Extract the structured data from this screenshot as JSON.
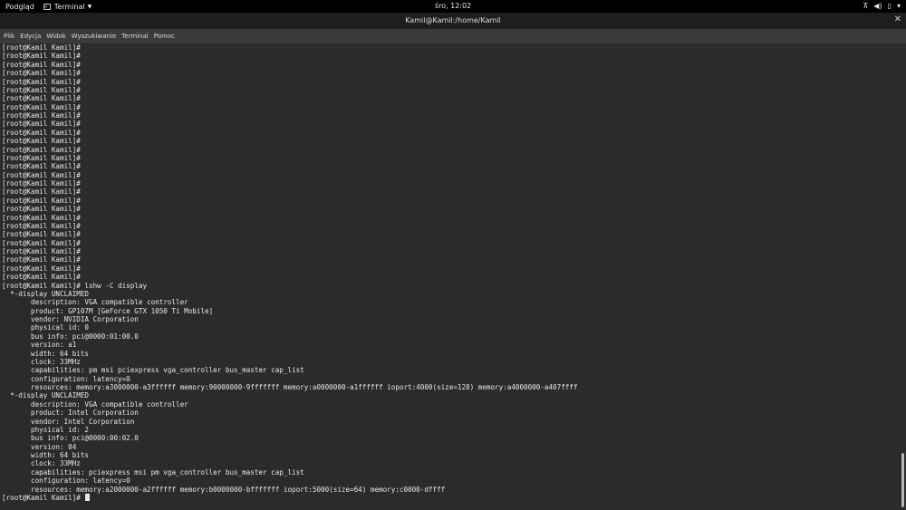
{
  "topbar": {
    "activities": "Podgląd",
    "app_name": "Terminal",
    "clock": "śro, 12:02",
    "tray_icons": [
      "network-icon",
      "volume-icon",
      "battery-icon",
      "power-menu-icon"
    ]
  },
  "window": {
    "title": "Kamil@Kamil:/home/Kamil",
    "close_glyph": "✕"
  },
  "menu": [
    "Plik",
    "Edycja",
    "Widok",
    "Wyszukiwanie",
    "Terminal",
    "Pomoc"
  ],
  "terminal": {
    "lines": [
      "[root@Kamil Kamil]#",
      "[root@Kamil Kamil]#",
      "[root@Kamil Kamil]#",
      "[root@Kamil Kamil]#",
      "[root@Kamil Kamil]#",
      "[root@Kamil Kamil]#",
      "[root@Kamil Kamil]#",
      "[root@Kamil Kamil]#",
      "[root@Kamil Kamil]#",
      "[root@Kamil Kamil]#",
      "[root@Kamil Kamil]#",
      "[root@Kamil Kamil]#",
      "[root@Kamil Kamil]#",
      "[root@Kamil Kamil]#",
      "[root@Kamil Kamil]#",
      "[root@Kamil Kamil]#",
      "[root@Kamil Kamil]#",
      "[root@Kamil Kamil]#",
      "[root@Kamil Kamil]#",
      "[root@Kamil Kamil]#",
      "[root@Kamil Kamil]#",
      "[root@Kamil Kamil]#",
      "[root@Kamil Kamil]#",
      "[root@Kamil Kamil]#",
      "[root@Kamil Kamil]#",
      "[root@Kamil Kamil]#",
      "[root@Kamil Kamil]#",
      "[root@Kamil Kamil]#",
      "[root@Kamil Kamil]# lshw -C display",
      "  *-display UNCLAIMED",
      "       description: VGA compatible controller",
      "       product: GP107M [GeForce GTX 1050 Ti Mobile]",
      "       vendor: NVIDIA Corporation",
      "       physical id: 0",
      "       bus info: pci@0000:01:00.0",
      "       version: a1",
      "       width: 64 bits",
      "       clock: 33MHz",
      "       capabilities: pm msi pciexpress vga_controller bus_master cap_list",
      "       configuration: latency=0",
      "       resources: memory:a3000000-a3ffffff memory:90000000-9fffffff memory:a0000000-a1ffffff ioport:4000(size=128) memory:a4000000-a407ffff",
      "  *-display UNCLAIMED",
      "       description: VGA compatible controller",
      "       product: Intel Corporation",
      "       vendor: Intel Corporation",
      "       physical id: 2",
      "       bus info: pci@0000:00:02.0",
      "       version: 04",
      "       width: 64 bits",
      "       clock: 33MHz",
      "       capabilities: pciexpress msi pm vga_controller bus_master cap_list",
      "       configuration: latency=0",
      "       resources: memory:a2000000-a2ffffff memory:b0000000-bfffffff ioport:5000(size=64) memory:c0000-dffff"
    ],
    "prompt": "[root@Kamil Kamil]# "
  },
  "colors": {
    "background": "#2b2b2b",
    "text": "#e8e8e8",
    "topbar": "#000000"
  }
}
